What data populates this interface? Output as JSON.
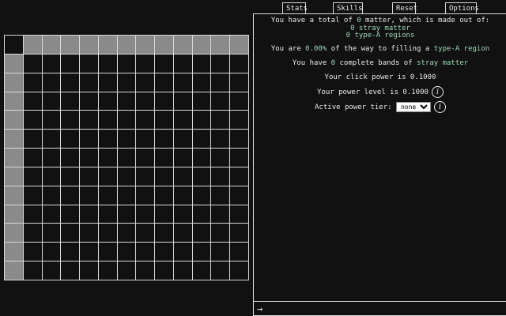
{
  "grid": {
    "rows": 13,
    "cols": 13,
    "filled_color": "#8a8a8a",
    "empty_color": "#111111",
    "border_color": "#d9d9d9"
  },
  "tabs": [
    {
      "label": "Stats"
    },
    {
      "label": "Skills"
    },
    {
      "label": "Reset"
    },
    {
      "label": "Options"
    }
  ],
  "stats": {
    "total_prefix": "You have a total of",
    "total_value": "0",
    "total_suffix": "matter, which is made out of:",
    "stray_value": "0",
    "stray_label": "stray matter",
    "typeA_value": "0",
    "typeA_label": "type-A regions",
    "progress_prefix": "You are",
    "progress_value": "0.00%",
    "progress_mid": "of the way to filling a",
    "progress_target": "type-A region",
    "bands_prefix": "You have",
    "bands_value": "0",
    "bands_mid": "complete bands of",
    "bands_target": "stray matter",
    "click_power_text": "Your click power is 0.1000",
    "power_level_text": "Your power level is 0.1000",
    "power_tier_label": "Active power tier:",
    "power_tier_selected": "none",
    "info_glyph": "i",
    "accent_color": "#9ed6b4"
  },
  "command": {
    "arrow": "→",
    "value": ""
  }
}
